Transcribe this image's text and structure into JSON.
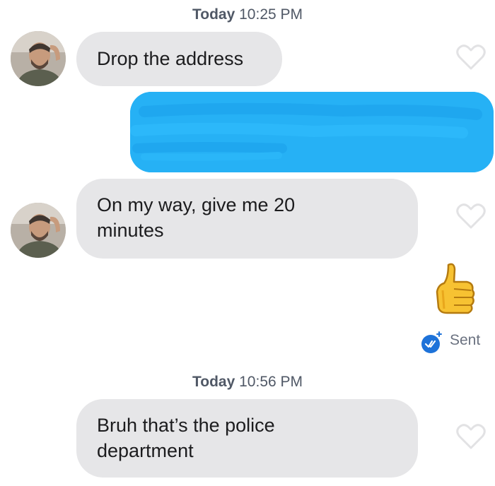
{
  "conversation": {
    "timestamps": [
      {
        "day": "Today",
        "time": "10:25 PM"
      },
      {
        "day": "Today",
        "time": "10:56 PM"
      }
    ],
    "messages": [
      {
        "from": "them",
        "text": "Drop the address"
      },
      {
        "from": "me",
        "text": "",
        "redacted": true
      },
      {
        "from": "them",
        "line1": "On my way, give me 20",
        "line2": "minutes"
      },
      {
        "from": "me",
        "emoji": "thumbs-up"
      },
      {
        "from": "them",
        "line1": "Bruh that’s the police",
        "line2": "department"
      }
    ],
    "status": {
      "label": "Sent"
    }
  },
  "colors": {
    "incoming_bubble": "#e6e6e8",
    "outgoing_bubble": "#26b1f5",
    "timestamp_text": "#505866",
    "sent_badge": "#1d72d9"
  },
  "icons": [
    "avatar",
    "heart-outline-icon",
    "thumbs-up-emoji",
    "sent-check-icon"
  ]
}
